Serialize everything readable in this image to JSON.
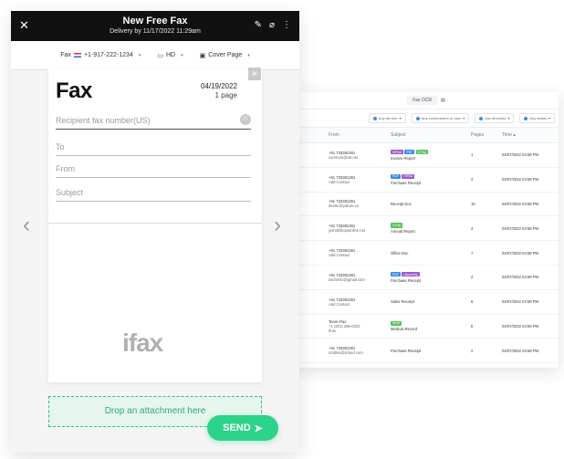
{
  "window": {
    "title": "New Free Fax",
    "subtitle": "Delivery by 11/17/2022 11:29am"
  },
  "toolbar": {
    "fax_number_label": "Fax",
    "fax_number": "+1-917-222-1234",
    "quality": "HD",
    "cover_page": "Cover Page"
  },
  "paper": {
    "heading": "Fax",
    "date": "04/19/2022",
    "pages": "1 page",
    "recipient_placeholder": "Recipient fax number(US)",
    "to_placeholder": "To",
    "from_placeholder": "From",
    "subject_placeholder": "Subject",
    "logo_text": "ifax"
  },
  "dropzone": {
    "label": "Drop an attachment here"
  },
  "send_button": {
    "label": "SEND"
  },
  "icons": {
    "close": "close-icon",
    "edit": "pencil-icon",
    "attach": "paperclip-icon",
    "more": "more-vertical-icon",
    "prev": "chevron-left-icon",
    "next": "chevron-right-icon",
    "contacts": "contacts-icon",
    "send": "send-arrow-icon"
  },
  "colors": {
    "accent": "#2ed38a",
    "header_bg": "#111111"
  },
  "history": {
    "search_placeholder": "Fax OCR",
    "filters": [
      "Any fax line",
      "Any environment or user",
      "Any direction",
      "Any status"
    ],
    "columns": [
      "From",
      "Subject",
      "Pages",
      "Time"
    ],
    "rows": [
      {
        "from1": "+61 733381361",
        "from2": "comscriii@att.net",
        "tags": [
          {
            "t": "HIPAA",
            "c": "#9b59d0"
          },
          {
            "t": "PDF",
            "c": "#3a8ee6"
          },
          {
            "t": "E-Pay",
            "c": "#59c25d"
          }
        ],
        "subject": "Invoice Report",
        "pages": "1",
        "time": "04/07/2022 04:59 PM"
      },
      {
        "from1": "+61 733381361",
        "from2": "Add Contact",
        "tags": [
          {
            "t": "PDF",
            "c": "#3a8ee6"
          },
          {
            "t": "HIPAA",
            "c": "#9b59d0"
          }
        ],
        "subject": "Purchase Receipt",
        "pages": "2",
        "time": "04/07/2022 04:59 PM"
      },
      {
        "from1": "+61 733381361",
        "from2": "dexter@yahoo.ca",
        "tags": [],
        "subject": "Receipt Doc",
        "pages": "10",
        "time": "04/07/2022 04:59 PM"
      },
      {
        "from1": "+61 733381361",
        "from2": "joshall@optonline.net",
        "tags": [
          {
            "t": "X-Pay",
            "c": "#59c25d"
          }
        ],
        "subject": "Annual Report",
        "pages": "4",
        "time": "04/07/2022 04:59 PM"
      },
      {
        "from1": "+61 733381361",
        "from2": "Add Contact",
        "tags": [],
        "subject": "Office Doc",
        "pages": "7",
        "time": "04/07/2022 04:59 PM"
      },
      {
        "from1": "+61 733381361",
        "from2": "aschmitz@gmail.com",
        "tags": [
          {
            "t": "PDF",
            "c": "#3a8ee6"
          },
          {
            "t": "Upcoming",
            "c": "#9b59d0"
          }
        ],
        "subject": "Purchase Receipt",
        "pages": "2",
        "time": "04/07/2022 04:59 PM"
      },
      {
        "from1": "+61 733381361",
        "from2": "Add Contact",
        "tags": [],
        "subject": "Sales Receipt",
        "pages": "6",
        "time": "04/07/2022 04:59 PM"
      },
      {
        "from1": "Team iFax",
        "from2": "+1 (201) 255-0222",
        "from3": "iFax",
        "tags": [
          {
            "t": "Send",
            "c": "#59c25d"
          }
        ],
        "subject": "Medical Record",
        "pages": "5",
        "time": "04/07/2022 04:59 PM"
      },
      {
        "from1": "+61 733381361",
        "from2": "crobles@icloud.com",
        "tags": [],
        "subject": "Purchase Receipt",
        "pages": "2",
        "time": "04/07/2022 04:59 PM"
      }
    ]
  }
}
